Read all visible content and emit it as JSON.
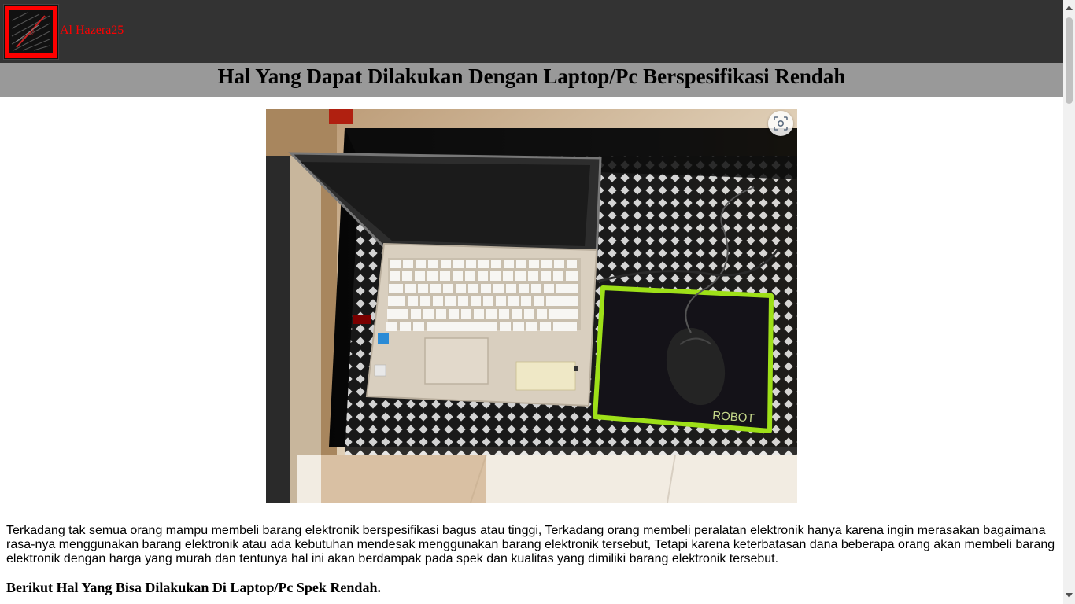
{
  "site": {
    "name": "Al Hazera25",
    "logo_icon": "logo-icon"
  },
  "page": {
    "title": "Hal Yang Dapat Dilakukan Dengan Laptop/Pc Berspesifikasi Rendah",
    "photo_icon": "laptop-photo",
    "lens_icon": "google-lens-icon"
  },
  "article": {
    "intro": "Terkadang tak semua orang mampu membeli barang elektronik berspesifikasi bagus atau tinggi, Terkadang orang membeli peralatan elektronik hanya karena ingin merasakan bagaimana rasa-nya menggunakan barang elektronik atau ada kebutuhan mendesak menggunakan barang elektronik tersebut, Tetapi karena keterbatasan dana beberapa orang akan membeli barang elektronik dengan harga yang murah dan tentunya hal ini akan berdampak pada spek dan kualitas yang dimiliki barang elektronik tersebut.",
    "subheading": "Berikut Hal Yang Bisa Dilakukan Di Laptop/Pc Spek Rendah."
  },
  "colors": {
    "header_bg": "#333333",
    "title_bar_bg": "#999999",
    "site_name": "#ff0000",
    "logo_border": "#ff0000"
  },
  "photo_text": {
    "mousepad_brand": "ROBOT"
  }
}
